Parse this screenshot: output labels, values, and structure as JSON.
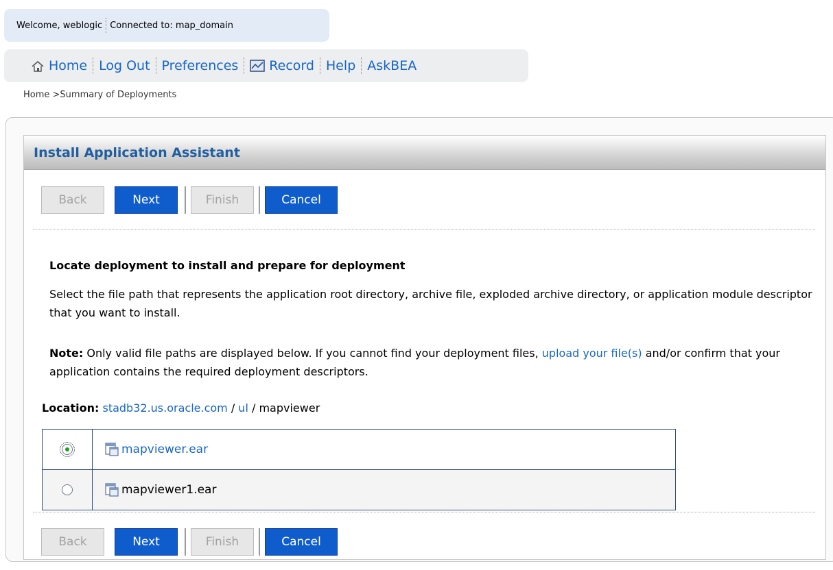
{
  "welcome": {
    "user_text": "Welcome, weblogic",
    "connected_text": "Connected to: map_domain"
  },
  "nav": {
    "home": "Home",
    "logout": "Log Out",
    "preferences": "Preferences",
    "record": "Record",
    "help": "Help",
    "askbea": "AskBEA"
  },
  "breadcrumb": "Home >Summary of Deployments",
  "panel": {
    "title": "Install Application Assistant",
    "buttons": {
      "back": "Back",
      "next": "Next",
      "finish": "Finish",
      "cancel": "Cancel"
    },
    "section_title": "Locate deployment to install and prepare for deployment",
    "description": "Select the file path that represents the application root directory, archive file, exploded archive directory, or application module descriptor that you want to install.",
    "note": {
      "label": "Note:",
      "text_before": " Only valid file paths are displayed below. If you cannot find your deployment files, ",
      "link": "upload your file(s)",
      "text_after": " and/or confirm that your application contains the required deployment descriptors."
    },
    "location": {
      "label": "Location:",
      "host": "stadb32.us.oracle.com",
      "sep1": " / ",
      "dir": "ul",
      "sep2": " / ",
      "current": "mapviewer"
    },
    "files": [
      {
        "name": "mapviewer.ear",
        "selected": true
      },
      {
        "name": "mapviewer1.ear",
        "selected": false
      }
    ]
  }
}
